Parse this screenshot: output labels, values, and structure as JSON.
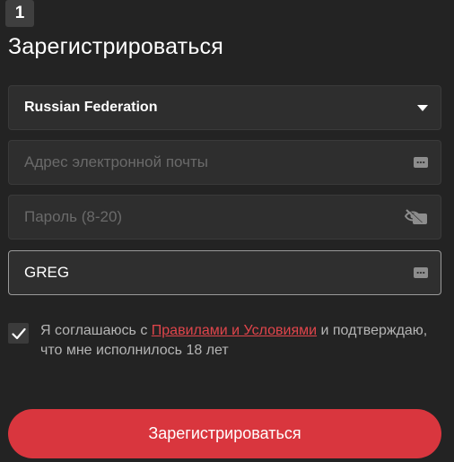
{
  "step": {
    "number": "1"
  },
  "header": {
    "title": "Зарегистрироваться"
  },
  "form": {
    "country": {
      "value": "Russian Federation",
      "icon": "chevron-down-icon"
    },
    "email": {
      "placeholder": "Адрес электронной почты",
      "icon": "dots-icon"
    },
    "password": {
      "placeholder": "Пароль (8-20)",
      "icon": "eye-off-icon"
    },
    "nickname": {
      "value": "GREG",
      "icon": "dots-icon"
    },
    "consent": {
      "checked": true,
      "text_before": "Я соглашаюсь с ",
      "link_text": "Правилами и Условиями",
      "text_after": " и подтверждаю, что мне исполнилось 18 лет"
    },
    "submit_label": "Зарегистрироваться"
  },
  "colors": {
    "background": "#232323",
    "field_background": "#2e2e2e",
    "accent": "#d9363e",
    "link": "#e0454b"
  }
}
